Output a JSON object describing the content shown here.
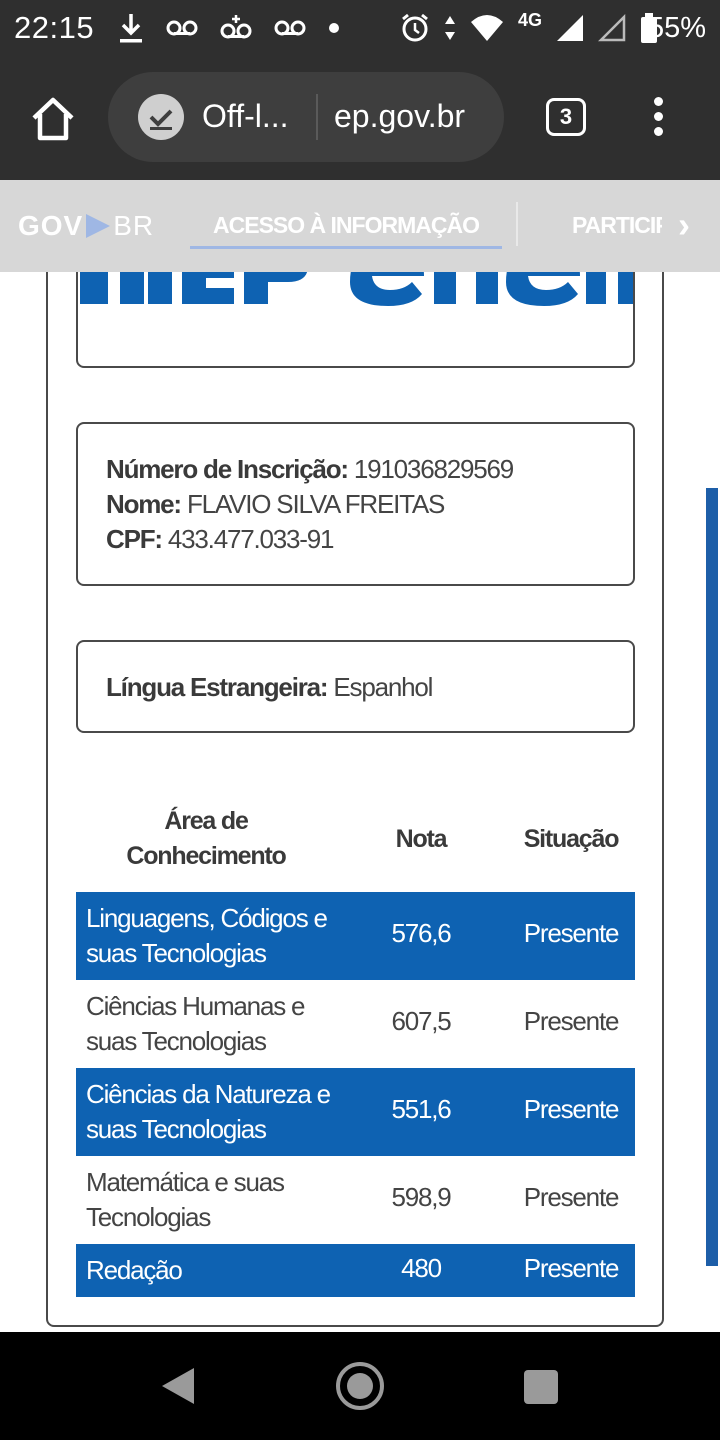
{
  "status_bar": {
    "time": "22:15",
    "network": "4G",
    "battery": "55%",
    "icons": [
      "download-icon",
      "voicemail-icon",
      "voicemail-plus-icon",
      "voicemail-icon",
      "dot-icon",
      "alarm-icon",
      "data-arrows-icon",
      "wifi-icon",
      "signal-icon",
      "signal-empty-icon",
      "battery-icon"
    ]
  },
  "browser": {
    "tab_title": "Off-l...",
    "domain": "ep.gov.br",
    "tab_count": "3"
  },
  "govnav": {
    "logo_gov": "GOV",
    "logo_br": "BR",
    "active_tab": "ACESSO À INFORMAÇÃO",
    "next_tab": "PARTICIPE"
  },
  "logos": {
    "left": "inep",
    "right": "enem",
    "color": "#0e62b2"
  },
  "candidate": {
    "inscricao_label": "Número de Inscrição:",
    "inscricao_value": "191036829569",
    "nome_label": "Nome:",
    "nome_value": "FLAVIO SILVA FREITAS",
    "cpf_label": "CPF:",
    "cpf_value": "433.477.033-91",
    "lingua_label": "Língua Estrangeira:",
    "lingua_value": "Espanhol"
  },
  "grades": {
    "header_area": "Área de Conhecimento",
    "header_nota": "Nota",
    "header_situacao": "Situação",
    "rows": [
      {
        "area": "Linguagens, Códigos e suas Tecnologias",
        "nota": "576,6",
        "situacao": "Presente"
      },
      {
        "area": "Ciências Humanas e suas Tecnologias",
        "nota": "607,5",
        "situacao": "Presente"
      },
      {
        "area": "Ciências da Natureza e suas Tecnologias",
        "nota": "551,6",
        "situacao": "Presente"
      },
      {
        "area": "Matemática e suas Tecnologias",
        "nota": "598,9",
        "situacao": "Presente"
      },
      {
        "area": "Redação",
        "nota": "480",
        "situacao": "Presente"
      }
    ]
  }
}
